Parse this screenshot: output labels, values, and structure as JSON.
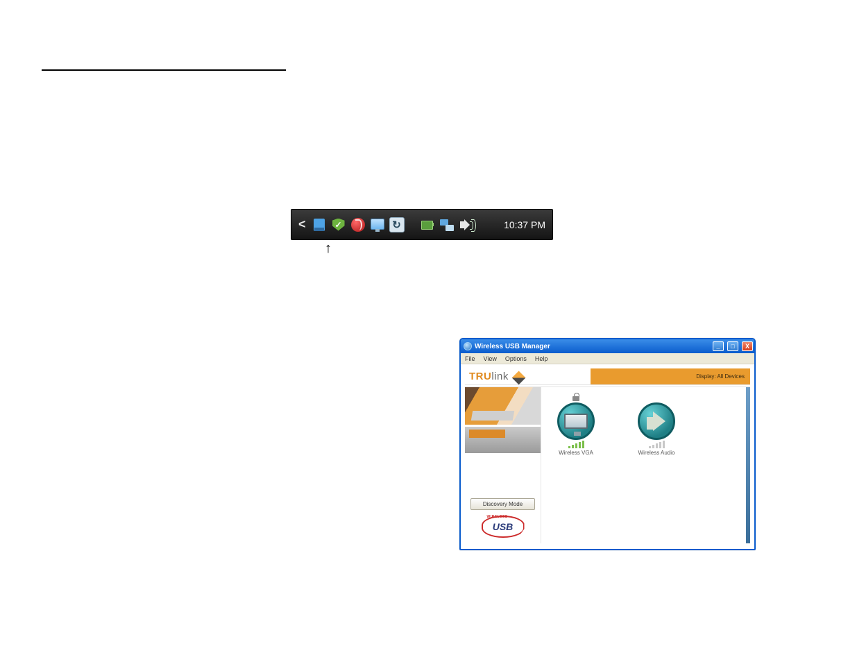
{
  "tray": {
    "clock": "10:37 PM",
    "icons": {
      "expand": "<",
      "usb": "wireless-usb-manager",
      "shield": "security-center",
      "av": "antivirus",
      "monitor": "display",
      "sync": "sync",
      "battery": "battery",
      "network": "network",
      "volume": "volume"
    }
  },
  "window": {
    "title": "Wireless USB Manager",
    "menu": {
      "file": "File",
      "view": "View",
      "options": "Options",
      "help": "Help"
    },
    "brand": {
      "tru": "TRU",
      "link": "link"
    },
    "display_label": "Display: All Devices",
    "discovery_button": "Discovery Mode",
    "usb_logo_top": "WIRELESS",
    "usb_logo_text": "USB",
    "devices": {
      "vga": "Wireless VGA",
      "audio": "Wireless Audio"
    },
    "controls": {
      "min": "_",
      "max": "□",
      "close": "X"
    }
  }
}
